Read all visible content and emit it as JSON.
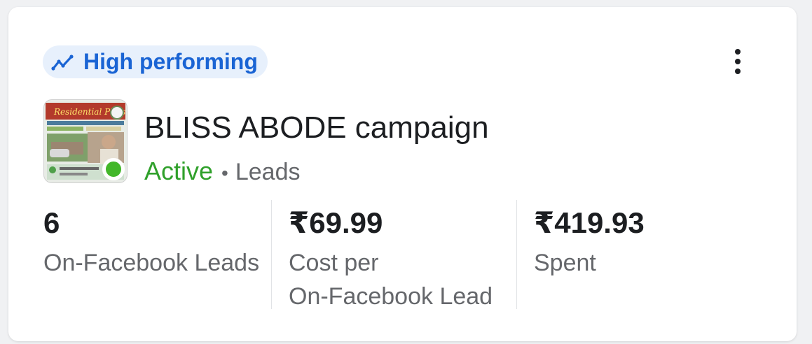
{
  "badge": {
    "label": "High performing",
    "icon": "trending-up-icon",
    "color": "#1a64d4",
    "background": "#e7f0fc"
  },
  "menu": {
    "icon": "more-vertical-icon"
  },
  "campaign": {
    "name": "BLISS ABODE campaign",
    "status": "Active",
    "status_color": "#42b72a",
    "separator": "•",
    "objective": "Leads",
    "thumbnail": "campaign-ad-thumbnail"
  },
  "metrics": [
    {
      "value": "6",
      "label": "On-Facebook Leads"
    },
    {
      "value": "₹69.99",
      "label_line1": "Cost per",
      "label_line2": "On-Facebook Lead"
    },
    {
      "value": "₹419.93",
      "label": "Spent"
    }
  ]
}
